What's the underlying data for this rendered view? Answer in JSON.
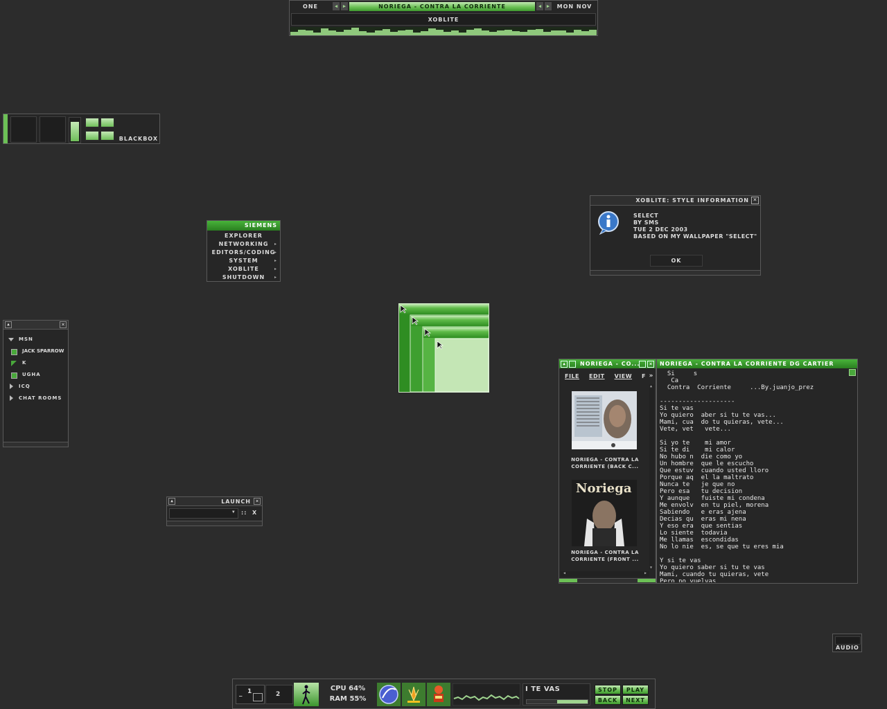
{
  "toolbar": {
    "workspace": "ONE",
    "window_label": "NORIEGA - CONTRA LA CORRIENTE",
    "clock": "MON NOV",
    "title": "XOBLITE",
    "eq_levels": [
      40,
      70,
      55,
      30,
      80,
      60,
      45,
      70,
      90,
      50,
      35,
      60,
      75,
      40,
      55,
      65,
      30,
      50,
      80,
      70,
      45,
      60,
      35,
      70,
      85,
      55,
      40,
      60,
      70,
      50,
      45,
      65,
      75,
      40,
      55,
      60,
      30,
      70,
      50,
      65
    ]
  },
  "slit": {
    "label": "BLACKBOX"
  },
  "menu": {
    "title": "SIEMENS",
    "items": [
      {
        "label": "EXPLORER",
        "sub": ""
      },
      {
        "label": "NETWORKING",
        "sub": "▸"
      },
      {
        "label": "EDITORS/CODING",
        "sub": "▸"
      },
      {
        "label": "SYSTEM",
        "sub": "▸"
      },
      {
        "label": "XOBLITE",
        "sub": "▸"
      },
      {
        "label": "SHUTDOWN",
        "sub": "▸"
      }
    ]
  },
  "msn": {
    "groups": [
      "msn",
      "ICQ",
      "CHAT ROOMS"
    ],
    "contacts": [
      "JACK SPARROW",
      "K",
      "UGHA"
    ]
  },
  "launch": {
    "title": "LAUNCH",
    "grip": "::",
    "close": "X"
  },
  "info": {
    "title": "XOBLITE: STYLE INFORMATION",
    "lines": [
      "SELECT",
      "BY SMS",
      "TUE 2 DEC 2003",
      "BASED ON MY WALLPAPER \"SELECT\""
    ],
    "ok": "OK"
  },
  "explorer": {
    "title": "NORIEGA - CO...",
    "menu": [
      "FILE",
      "EDIT",
      "VIEW",
      "F"
    ],
    "files": [
      "NORIEGA - CONTRA LA CORRIENTE (BACK C...",
      "NORIEGA - CONTRA LA CORRIENTE (FRONT ..."
    ]
  },
  "lyrics": {
    "title": "NORIEGA - CONTRA LA CORRIENTE DG CARTIER",
    "text": "  Si     s\n   Ca\n  Contra  Corriente     ...By.juanjo_prez\n\n--------------------\nSi te vas\nYo quiero  aber si tu te vas...\nMami, cua  do tu quieras, vete...\nVete, vet   vete...\n\nSi yo te    mi amor\nSi te di    mi calor\nNo hubo n  die como yo\nUn hombre  que le escucho\nQue estuv  cuando usted lloro\nPorque aq  el la maltrato\nNunca te   je que no\nPero esa   tu decision\nY aunque   fuiste mi condena\nMe envolv  en tu piel, morena\nSabiendo   e eras ajena\nDecias qu  eras mi nena\nY eso era  que sentias\nLo siente  todavia\nMe llamas  escondidas\nNo lo nie  es, se que tu eres mia\n\nY si te vas\nYo quiero saber si tu te vas\nMami, cuando tu quieras, vete\nPero no vuelvas"
  },
  "audio": {
    "label": "AUDIO"
  },
  "taskbar": {
    "ws1": "1",
    "ws2": "2",
    "cpu": "CPU 64%",
    "ram": "RAM 55%",
    "track": "I TE VAS",
    "stop": "STOP",
    "play": "PLAY",
    "back": "BACK",
    "next": "NEXT"
  }
}
